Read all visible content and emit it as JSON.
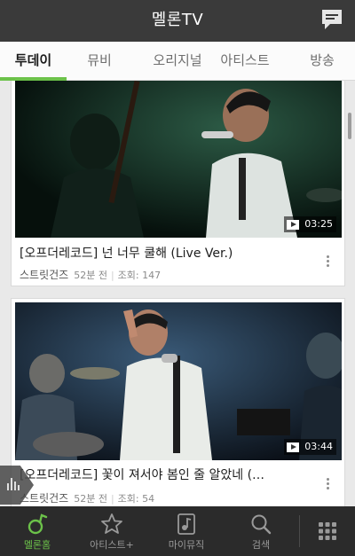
{
  "header": {
    "title": "멜론TV"
  },
  "tabs": [
    {
      "label": "투데이"
    },
    {
      "label": "뮤비"
    },
    {
      "label": "오리지널"
    },
    {
      "label": "아티스트"
    },
    {
      "label": "방송"
    }
  ],
  "videos": [
    {
      "title": "[오프더레코드] 넌 너무 쿨해 (Live Ver.)",
      "artist": "스트릿건즈",
      "time_ago": "52분 전",
      "views": "조회: 147",
      "duration": "03:25"
    },
    {
      "title": "[오프더레코드] 꽃이 져서야 봄인 줄 알았네 (…",
      "artist": "스트릿건즈",
      "time_ago": "52분 전",
      "views": "조회: 54",
      "duration": "03:44"
    }
  ],
  "bottom_nav": [
    {
      "label": "멜론홈",
      "icon": "melon-note-icon"
    },
    {
      "label": "아티스트+",
      "icon": "star-icon"
    },
    {
      "label": "마이뮤직",
      "icon": "music-note-icon"
    },
    {
      "label": "검색",
      "icon": "search-icon"
    },
    {
      "label": "",
      "icon": "grid-menu-icon"
    }
  ],
  "colors": {
    "accent": "#6cc24a",
    "header_bg": "#3a3a3a",
    "nav_bg": "#2b2b2b"
  }
}
